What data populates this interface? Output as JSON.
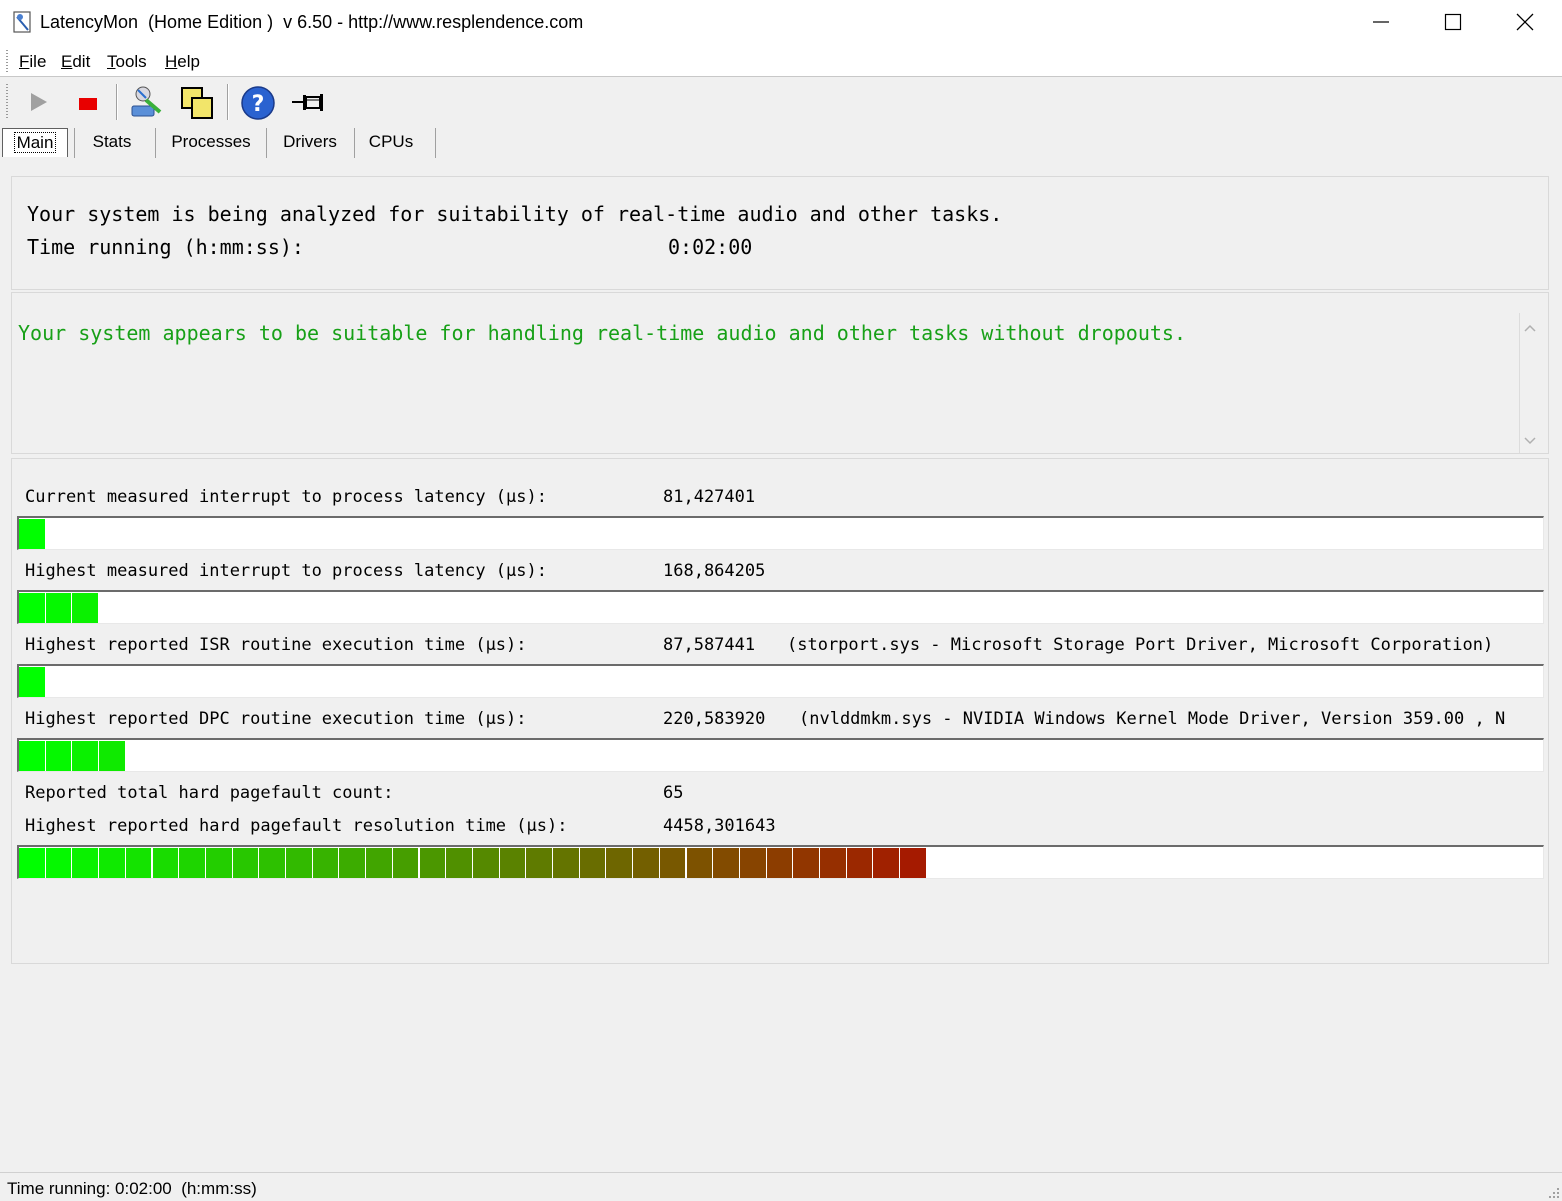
{
  "window": {
    "title": "LatencyMon  (Home Edition )  v 6.50 - http://www.resplendence.com"
  },
  "menu": {
    "items": [
      "File",
      "Edit",
      "Tools",
      "Help"
    ]
  },
  "toolbar": {
    "buttons": [
      "play-icon",
      "stop-icon",
      "processes-icon",
      "windows-icon",
      "help-icon",
      "pin-icon"
    ]
  },
  "tabs": [
    {
      "label": "Main",
      "active": true
    },
    {
      "label": "Stats",
      "active": false
    },
    {
      "label": "Processes",
      "active": false
    },
    {
      "label": "Drivers",
      "active": false
    },
    {
      "label": "CPUs",
      "active": false
    }
  ],
  "analysis": {
    "line": "Your system is being analyzed for suitability of real-time audio and other tasks.",
    "time_label": "Time running (h:mm:ss):",
    "time_value": "0:02:00"
  },
  "verdict": {
    "message": "Your system appears to be suitable for handling real-time audio and other tasks without dropouts.",
    "color": "#17a017"
  },
  "metrics": [
    {
      "label": "Current measured interrupt to process latency (µs):",
      "value": "81,427401",
      "extra": "",
      "segments": 1
    },
    {
      "label": "Highest measured interrupt to process latency (µs):",
      "value": "168,864205",
      "extra": "",
      "segments": 3
    },
    {
      "label": "Highest reported ISR routine execution time (µs):",
      "value": "87,587441",
      "extra": "(storport.sys - Microsoft Storage Port Driver, Microsoft Corporation)",
      "segments": 1
    },
    {
      "label": "Highest reported DPC routine execution time (µs):",
      "value": "220,583920",
      "extra": "(nvlddmkm.sys - NVIDIA Windows Kernel Mode Driver, Version 359.00 , N",
      "segments": 4
    },
    {
      "label": "Reported total hard pagefault count:",
      "value": "65",
      "extra": "",
      "segments": 0
    },
    {
      "label": "Highest reported hard pagefault resolution time (µs):",
      "value": "4458,301643",
      "extra": "",
      "segments": 34
    }
  ],
  "bar_colors": {
    "start": "#00ff00",
    "end": "#a51a00"
  },
  "status": {
    "text": "Time running: 0:02:00  (h:mm:ss)"
  }
}
